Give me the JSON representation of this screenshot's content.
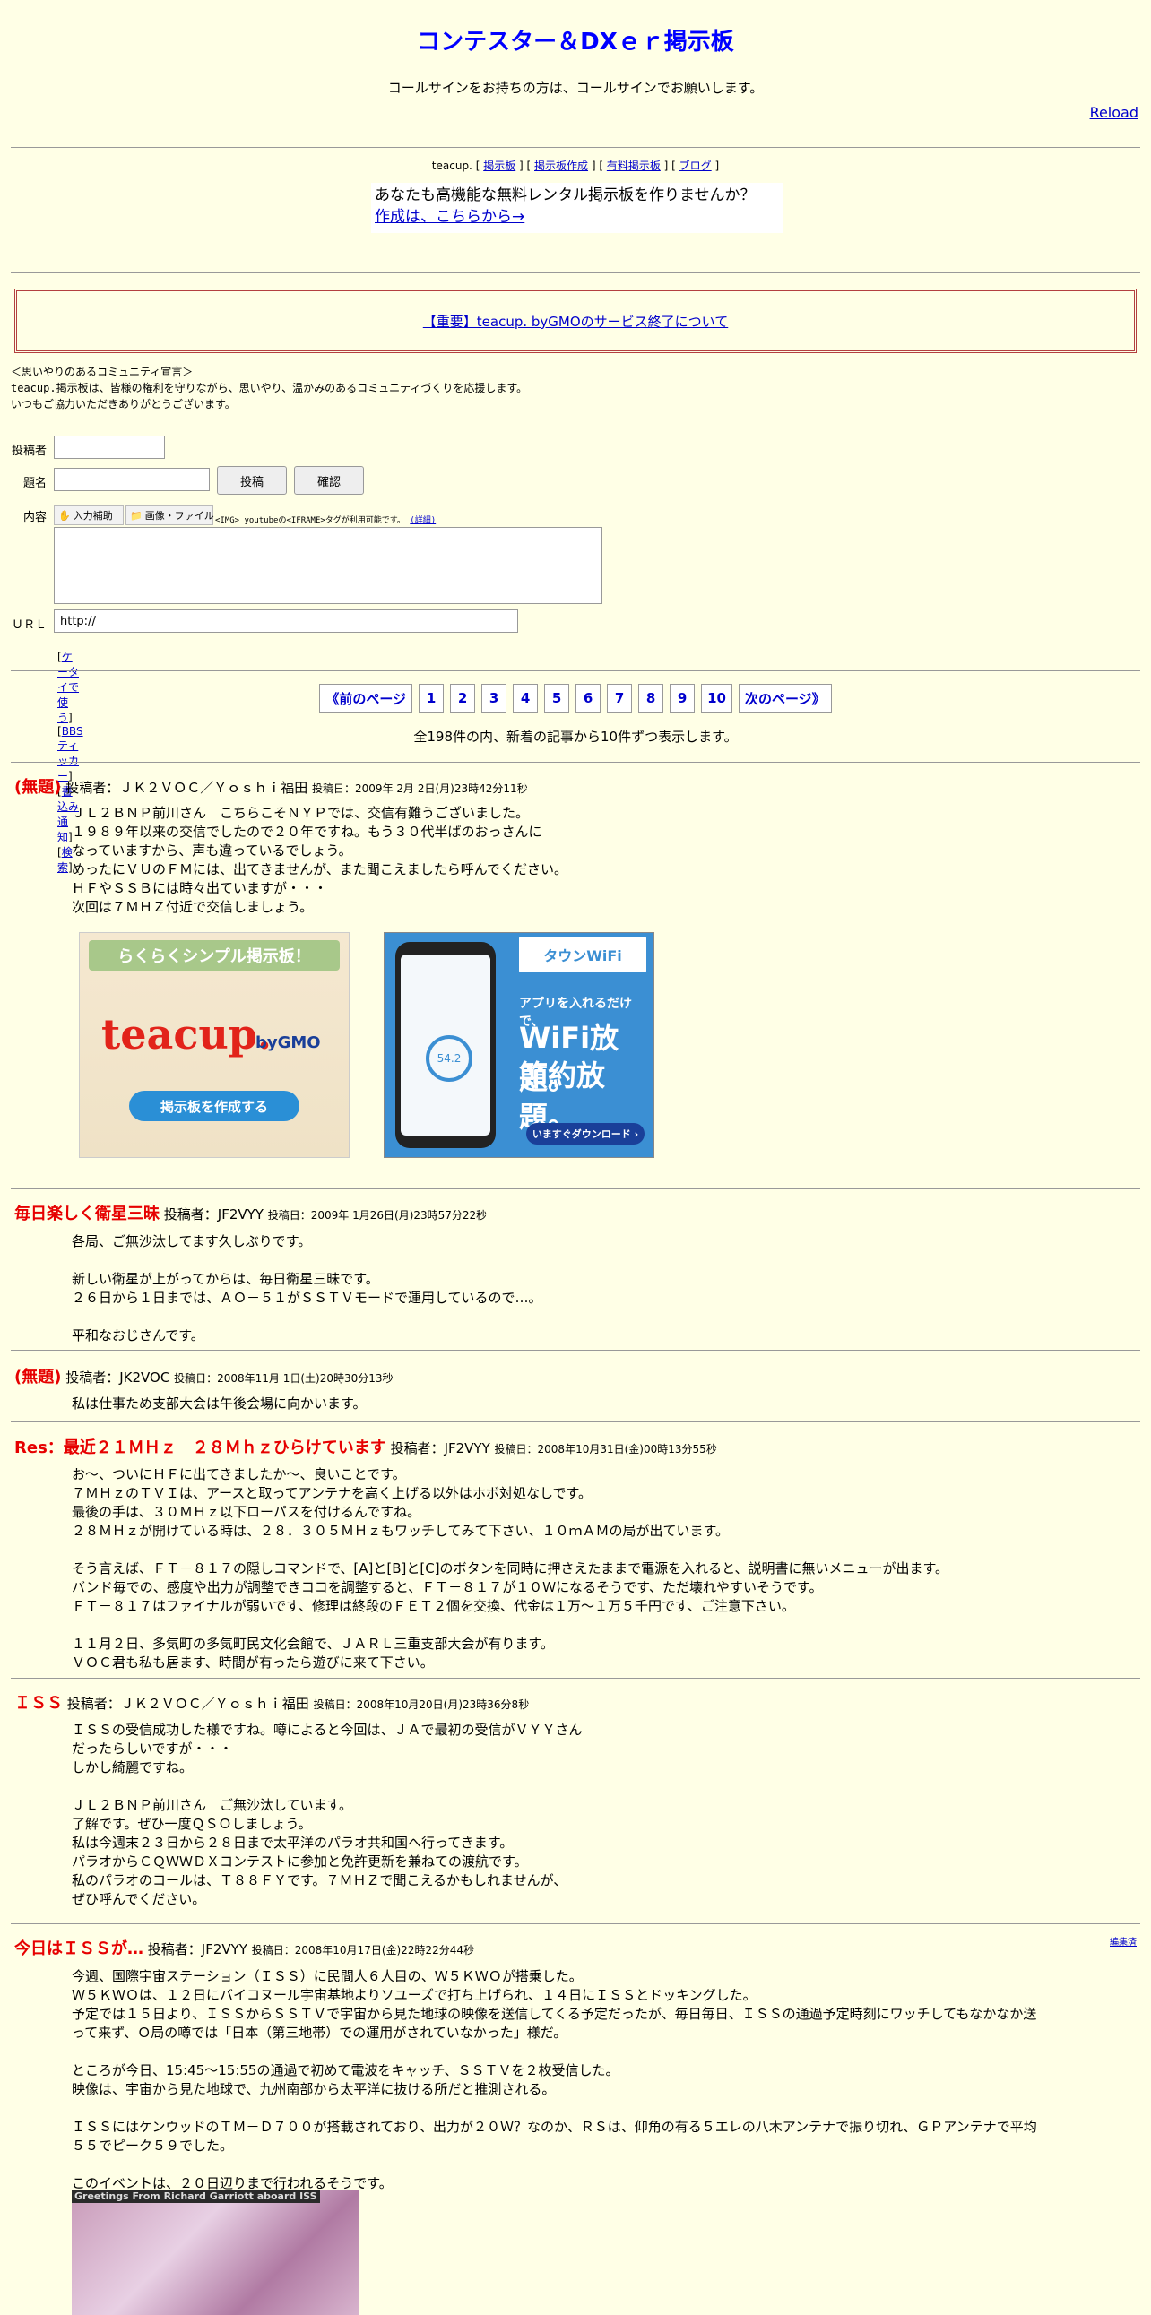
{
  "header": {
    "title": "コンテスター＆DXｅｒ掲示板",
    "lead": "コールサインをお持ちの方は、コールサインでお願いします。",
    "reload": "Reload"
  },
  "topnav": {
    "brand": "teacup.",
    "links": [
      "掲示板",
      "掲示板作成",
      "有料掲示板",
      "ブログ"
    ]
  },
  "promo": {
    "line1": "あなたも高機能な無料レンタル掲示板を作りませんか？",
    "line2": "作成は、こちらから→"
  },
  "notice": "【重要】teacup. byGMOのサービス終了について",
  "declaration": {
    "l1": "＜思いやりのあるコミュニティ宣言＞",
    "l2": "teacup.掲示板は、皆様の権利を守りながら、思いやり、温かみのあるコミュニティづくりを応援します。",
    "l3": "いつもご協力いただきありがとうございます。"
  },
  "form": {
    "poster_label": "投稿者",
    "subject_label": "題名",
    "content_label": "内容",
    "url_label": "ＵＲＬ",
    "submit": "投稿",
    "confirm": "確認",
    "tool_input": "入力補助",
    "tool_image": "画像・ファイル",
    "hint": "<IMG> youtubeの<IFRAME>タグが利用可能です。",
    "hint_link": "(詳細)",
    "url_value": "http://",
    "links": [
      "ケータイで使う",
      "BBSティッカー",
      "書込み通知",
      "検索"
    ]
  },
  "pager": {
    "prev": "《前のページ",
    "pages": [
      "1",
      "2",
      "3",
      "4",
      "5",
      "6",
      "7",
      "8",
      "9",
      "10"
    ],
    "next": "次のページ》",
    "summary": "全198件の内、新着の記事から10件ずつ表示します。"
  },
  "posts": [
    {
      "subject": "(無題)",
      "by": "投稿者：ＪＫ２ＶＯＣ／Ｙｏｓｈｉ福田",
      "date": "投稿日：2009年 2月 2日(月)23時42分11秒",
      "body": "ＪＬ２ＢＮＰ前川さん　こちらこそＮＹＰでは、交信有難うございました。\n１９８９年以来の交信でしたので２０年ですね。もう３０代半ばのおっさんに\nなっていますから、声も違っているでしょう。\nめったにＶＵのＦＭには、出てきませんが、また聞こえましたら呼んでください。\nＨＦやＳＳＢには時々出ていますが・・・\n次回は７ＭＨＺ付近で交信しましょう。"
    },
    {
      "subject": "毎日楽しく衛星三昧",
      "by": "投稿者：JF2VYY",
      "date": "投稿日：2009年 1月26日(月)23時57分22秒",
      "body": "各局、ご無沙汰してます久しぶりです。\n\n新しい衛星が上がってからは、毎日衛星三昧です。\n２６日から１日までは、ＡＯ－５１がＳＳＴＶモードで運用しているので…。\n\n平和なおじさんです。"
    },
    {
      "subject": "(無題)",
      "by": "投稿者：JK2VOC",
      "date": "投稿日：2008年11月 1日(土)20時30分13秒",
      "body": "私は仕事ため支部大会は午後会場に向かいます。"
    },
    {
      "subject": "Res：最近２１ＭＨｚ　２８Ｍｈｚひらけています",
      "by": "投稿者：JF2VYY",
      "date": "投稿日：2008年10月31日(金)00時13分55秒",
      "body": "お～、ついにＨＦに出てきましたか～、良いことです。\n７ＭＨｚのＴＶＩは、アースと取ってアンテナを高く上げる以外はホボ対処なしです。\n最後の手は、３０ＭＨｚ以下ローパスを付けるんですね。\n２８ＭＨｚが開けている時は、２８．３０５ＭＨｚもワッチしてみて下さい、１０ｍＡＭの局が出ています。\n\nそう言えば、ＦＴ－８１７の隠しコマンドで、[A]と[B]と[C]のボタンを同時に押さえたままで電源を入れると、説明書に無いメニューが出ます。\nバンド毎での、感度や出力が調整できココを調整すると、ＦＴ－８１７が１０Ｗになるそうです、ただ壊れやすいそうです。\nＦＴ－８１７はファイナルが弱いです、修理は終段のＦＥＴ２個を交換、代金は１万～１万５千円です、ご注意下さい。\n\n１１月２日、多気町の多気町民文化会館で、ＪＡＲＬ三重支部大会が有ります。\nＶＯＣ君も私も居ます、時間が有ったら遊びに来て下さい。"
    },
    {
      "subject": "ＩＳＳ",
      "by": "投稿者：ＪＫ２ＶＯＣ／Ｙｏｓｈｉ福田",
      "date": "投稿日：2008年10月20日(月)23時36分8秒",
      "body": "ＩＳＳの受信成功した様ですね。噂によると今回は、ＪＡで最初の受信がＶＹＹさん\nだったらしいですが・・・\nしかし綺麗ですね。\n\nＪＬ２ＢＮＰ前川さん　ご無沙汰しています。\n了解です。ぜひ一度ＱＳＯしましょう。\n私は今週末２３日から２８日まで太平洋のパラオ共和国へ行ってきます。\nパラオからＣＱＷＷＤＸコンテストに参加と免許更新を兼ねての渡航です。\n私のパラオのコールは、Ｔ８８ＦＹです。７ＭＨＺで聞こえるかもしれませんが、\nぜひ呼んでください。"
    },
    {
      "subject": "今日はＩＳＳが…",
      "by": "投稿者：JF2VYY",
      "date": "投稿日：2008年10月17日(金)22時22分44秒",
      "edit": "編集済",
      "body": "今週、国際宇宙ステーション（ＩＳＳ）に民間人６人目の、Ｗ５ＫＷＯが搭乗した。\nＷ５ＫＷＯは、１２日にバイコヌール宇宙基地よりソユーズで打ち上げられ、１４日にＩＳＳとドッキングした。\n予定では１５日より、ＩＳＳからＳＳＴＶで宇宙から見た地球の映像を送信してくる予定だったが、毎日毎日、ＩＳＳの通過予定時刻にワッチしてもなかなか送\nって来ず、Ｏ局の噂では「日本（第三地帯）での運用がされていなかった」様だ。\n\nところが今日、15:45～15:55の通過で初めて電波をキャッチ、ＳＳＴＶを２枚受信した。\n映像は、宇宙から見た地球で、九州南部から太平洋に抜ける所だと推測される。\n\nＩＳＳにはケンウッドのＴＭ－Ｄ７００が搭載されており、出力が２０Ｗ？なのか、ＲＳは、仰角の有る５エレの八木アンテナで振り切れ、ＧＰアンテナで平均\n５５でピーク５９でした。\n\nこのイベントは、２０日辺りまで行われるそうです。",
      "image_caption": "Greetings From Richard Garriott aboard ISS"
    }
  ],
  "ads": {
    "ad1_title": "らくらくシンプル掲示板！",
    "ad1_logo": "teacup.",
    "ad1_by": "byGMO",
    "ad1_button": "掲示板を作成する",
    "ad2_brand": "タウンWiFi",
    "ad2_line1": "アプリを入れるだけで、",
    "ad2_line2": "WiFi放題。",
    "ad2_line3": "節約放題。",
    "ad2_button": "いますぐダウンロード ›",
    "ad2_value": "54.2"
  }
}
